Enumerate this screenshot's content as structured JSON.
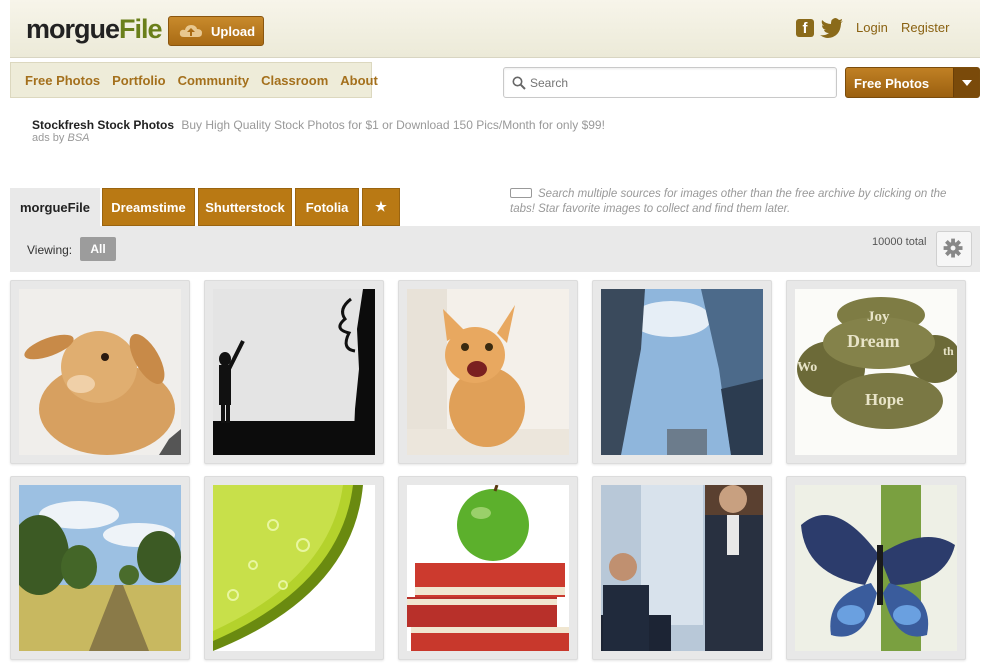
{
  "header": {
    "logo_part1": "morgue",
    "logo_part2": "File",
    "upload_label": "Upload",
    "facebook_glyph": "f",
    "login": "Login",
    "register": "Register"
  },
  "nav": {
    "items": [
      "Free Photos",
      "Portfolio",
      "Community",
      "Classroom",
      "About"
    ]
  },
  "search": {
    "placeholder": "Search",
    "source_selected": "Free Photos"
  },
  "ad": {
    "title": "Stockfresh Stock Photos",
    "text": "Buy High Quality Stock Photos for $1 or Download 150 Pics/Month for only $99!",
    "ads_by": "ads by",
    "ads_by_brand": "BSA"
  },
  "tabs": {
    "items": [
      "morgueFile",
      "Dreamstime",
      "Shutterstock",
      "Fotolia"
    ],
    "star_glyph": "★",
    "tip": "Search multiple sources for images other than the free archive by clicking on the tabs! Star favorite images to collect and find them later."
  },
  "viewbar": {
    "viewing_label": "Viewing:",
    "filter": "All",
    "total": "10000 total"
  },
  "stones": {
    "words": [
      "Joy",
      "Dream",
      "Wo",
      "Hope",
      "th"
    ]
  },
  "photos": [
    "bunny",
    "silhouette",
    "kitten",
    "skyscrapers",
    "word-stones",
    "country-road",
    "lime-slice",
    "apple-on-books",
    "business-men",
    "butterfly"
  ],
  "colors": {
    "brand_brown": "#b97914",
    "link_brown": "#a4701c",
    "logo_green": "#6a7f1a"
  }
}
